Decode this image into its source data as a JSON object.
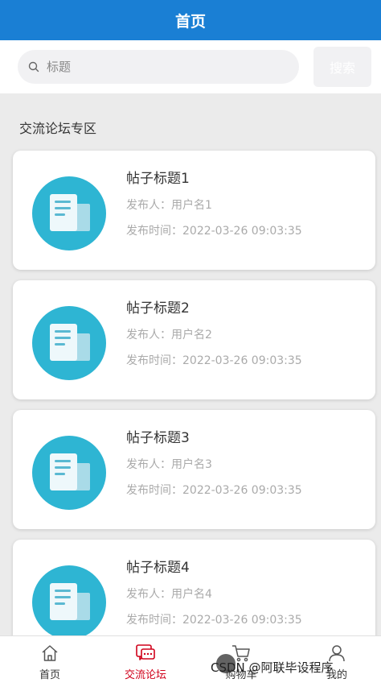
{
  "header": {
    "title": "首页"
  },
  "search": {
    "placeholder": "标题",
    "button_label": "搜索"
  },
  "section": {
    "title": "交流论坛专区"
  },
  "posts": [
    {
      "title": "帖子标题1",
      "author": "发布人：用户名1",
      "time": "发布时间：2022-03-26 09:03:35"
    },
    {
      "title": "帖子标题2",
      "author": "发布人：用户名2",
      "time": "发布时间：2022-03-26 09:03:35"
    },
    {
      "title": "帖子标题3",
      "author": "发布人：用户名3",
      "time": "发布时间：2022-03-26 09:03:35"
    },
    {
      "title": "帖子标题4",
      "author": "发布人：用户名4",
      "time": "发布时间：2022-03-26 09:03:35"
    }
  ],
  "tabbar": {
    "items": [
      {
        "label": "首页",
        "icon": "home-icon"
      },
      {
        "label": "交流论坛",
        "icon": "forum-icon",
        "active": true
      },
      {
        "label": "购物车",
        "icon": "cart-icon"
      },
      {
        "label": "我的",
        "icon": "user-icon"
      }
    ]
  },
  "watermark": "CSDN @阿联毕设程序",
  "colors": {
    "header": "#1a7fd4",
    "accent": "#2eb5d3",
    "active_tab": "#d0021b"
  }
}
